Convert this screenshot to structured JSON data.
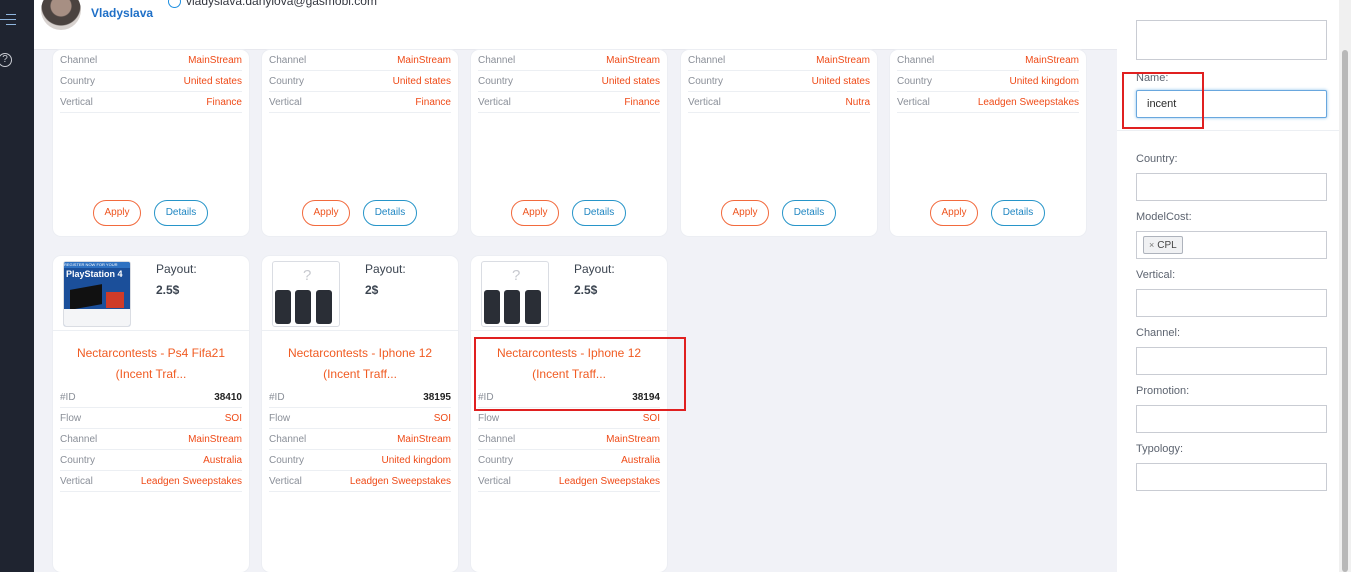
{
  "user": {
    "name": "Vladyslava",
    "email": "vladyslava.danylova@gasmobi.com"
  },
  "labels": {
    "channel": "Channel",
    "country": "Country",
    "vertical": "Vertical",
    "id": "#ID",
    "flow": "Flow",
    "payout": "Payout:",
    "apply": "Apply",
    "details": "Details"
  },
  "top_cards": [
    {
      "channel": "MainStream",
      "country": "United states",
      "vertical": "Finance"
    },
    {
      "channel": "MainStream",
      "country": "United states",
      "vertical": "Finance"
    },
    {
      "channel": "MainStream",
      "country": "United states",
      "vertical": "Finance"
    },
    {
      "channel": "MainStream",
      "country": "United states",
      "vertical": "Nutra"
    },
    {
      "channel": "MainStream",
      "country": "United kingdom",
      "vertical": "Leadgen Sweepstakes"
    }
  ],
  "offers": [
    {
      "image_icon": "ps4-offer-image",
      "image_title": "PlayStation 4",
      "image_banner": "REGISTER NOW FOR YOUR",
      "payout": "2.5$",
      "title_line1": "Nectarcontests - Ps4 Fifa21",
      "title_line2": "(Incent Traf...",
      "id": "38410",
      "flow": "SOI",
      "channel": "MainStream",
      "country": "Australia",
      "vertical": "Leadgen Sweepstakes"
    },
    {
      "image_icon": "iphone-offer-image",
      "image_placeholder": "?",
      "payout": "2$",
      "title_line1": "Nectarcontests - Iphone 12",
      "title_line2": "(Incent Traff...",
      "id": "38195",
      "flow": "SOI",
      "channel": "MainStream",
      "country": "United kingdom",
      "vertical": "Leadgen Sweepstakes"
    },
    {
      "image_icon": "iphone-offer-image",
      "image_placeholder": "?",
      "payout": "2.5$",
      "title_line1": "Nectarcontests - Iphone 12",
      "title_line2": "(Incent Traff...",
      "id": "38194",
      "flow": "SOI",
      "channel": "MainStream",
      "country": "Australia",
      "vertical": "Leadgen Sweepstakes"
    }
  ],
  "filters": {
    "name": {
      "label": "Name:",
      "value": "incent"
    },
    "country": {
      "label": "Country:"
    },
    "modelcost": {
      "label": "ModelCost:",
      "tag": "CPL",
      "tag_remove": "×"
    },
    "vertical": {
      "label": "Vertical:"
    },
    "channel": {
      "label": "Channel:"
    },
    "promotion": {
      "label": "Promotion:"
    },
    "typology": {
      "label": "Typology:"
    }
  },
  "icons": {
    "menu": "hamburger-menu-icon",
    "help": "help-circle-icon",
    "email": "email-status-icon",
    "user_menu": "users-gear-icon"
  },
  "colors": {
    "accent": "#ef4a17",
    "link": "#1e6fc7",
    "highlight": "#e02020",
    "details": "#1f86c2"
  }
}
